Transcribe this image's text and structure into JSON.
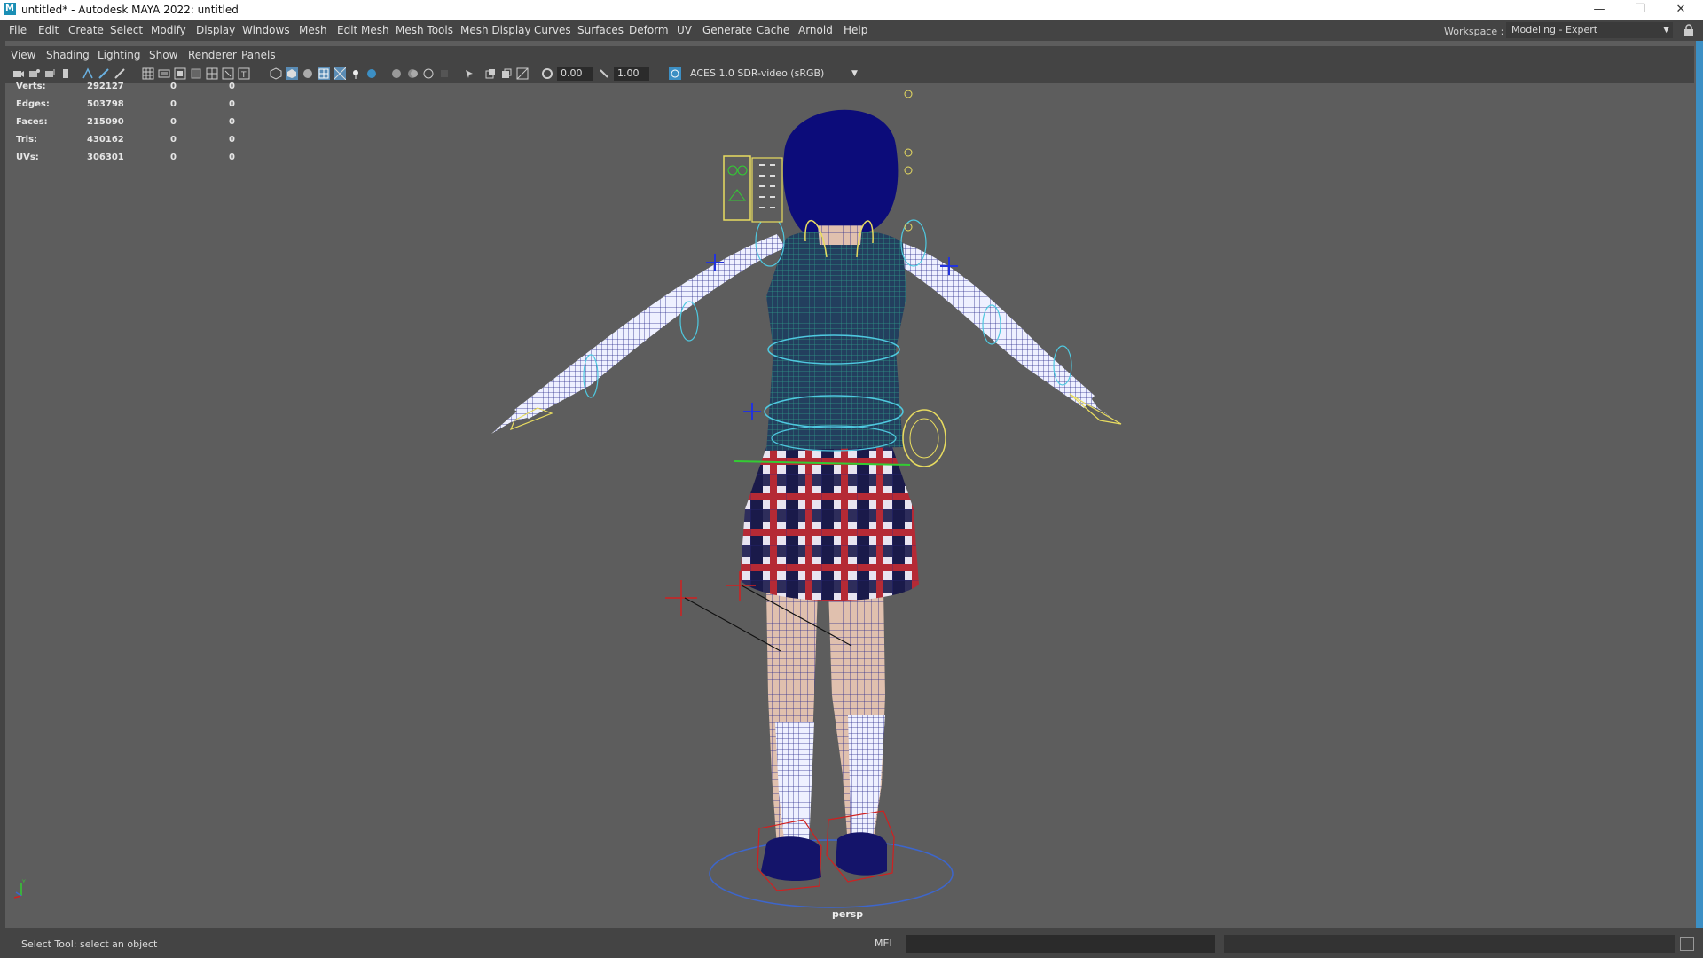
{
  "window": {
    "title": "untitled* - Autodesk MAYA 2022: untitled",
    "logo": "M",
    "minimize": "—",
    "restore": "❐",
    "close": "✕"
  },
  "menubar": {
    "items": [
      "File",
      "Edit",
      "Create",
      "Select",
      "Modify",
      "Display",
      "Windows",
      "Mesh",
      "Edit Mesh",
      "Mesh Tools",
      "Mesh Display",
      "Curves",
      "Surfaces",
      "Deform",
      "UV",
      "Generate",
      "Cache",
      "Arnold",
      "Help"
    ],
    "workspace_label": "Workspace :",
    "workspace_value": "Modeling - Expert"
  },
  "panel_menu": {
    "items": [
      "View",
      "Shading",
      "Lighting",
      "Show",
      "Renderer",
      "Panels"
    ]
  },
  "toolbar": {
    "exposure": "0.00",
    "gamma": "1.00",
    "color_space": "ACES 1.0 SDR-video (sRGB)"
  },
  "hud": {
    "rows": [
      {
        "label": "Verts:",
        "v1": "292127",
        "v2": "0",
        "v3": "0"
      },
      {
        "label": "Edges:",
        "v1": "503798",
        "v2": "0",
        "v3": "0"
      },
      {
        "label": "Faces:",
        "v1": "215090",
        "v2": "0",
        "v3": "0"
      },
      {
        "label": "Tris:",
        "v1": "430162",
        "v2": "0",
        "v3": "0"
      },
      {
        "label": "UVs:",
        "v1": "306301",
        "v2": "0",
        "v3": "0"
      }
    ]
  },
  "viewport": {
    "camera": "persp",
    "axis_y": "Y"
  },
  "status": {
    "message": "Select Tool: select an object",
    "lang": "MEL"
  },
  "colors": {
    "accent": "#3c8fc4",
    "bg": "#5d5d5d",
    "panel": "#444444",
    "hair": "#0c0c7a",
    "skirt_red": "#b52a35",
    "skirt_navy": "#1a1a4a"
  }
}
